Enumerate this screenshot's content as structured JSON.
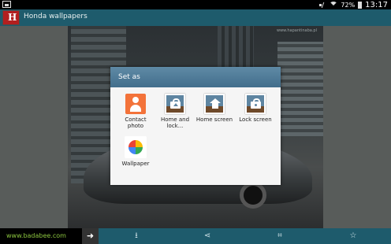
{
  "status_bar": {
    "battery": "72%",
    "time": "13:17",
    "icons": [
      "notification-icon",
      "mute-icon",
      "wifi-icon",
      "battery-icon"
    ]
  },
  "action_bar": {
    "title": "Honda wallpapers",
    "icon": "honda-app-icon"
  },
  "photo": {
    "watermark": "www.hapantinaba.pl"
  },
  "dialog": {
    "title": "Set as",
    "options": [
      {
        "label": "Contact photo",
        "icon": "contact-photo-icon"
      },
      {
        "label": "Home and lock...",
        "icon": "home-and-lock-icon"
      },
      {
        "label": "Home screen",
        "icon": "home-screen-icon"
      },
      {
        "label": "Lock screen",
        "icon": "lock-screen-icon"
      },
      {
        "label": "Wallpaper",
        "icon": "wallpaper-icon"
      }
    ]
  },
  "ad": {
    "text": "www.badabee.com",
    "arrow": "➜"
  },
  "bottom_bar": {
    "download": "⭳",
    "share": "⋖",
    "crop": "⌗",
    "favorite": "☆"
  },
  "colors": {
    "action_bar": "#1e5b6c",
    "dialog_header": "#426e8c",
    "ad_text": "#8cc63f"
  }
}
